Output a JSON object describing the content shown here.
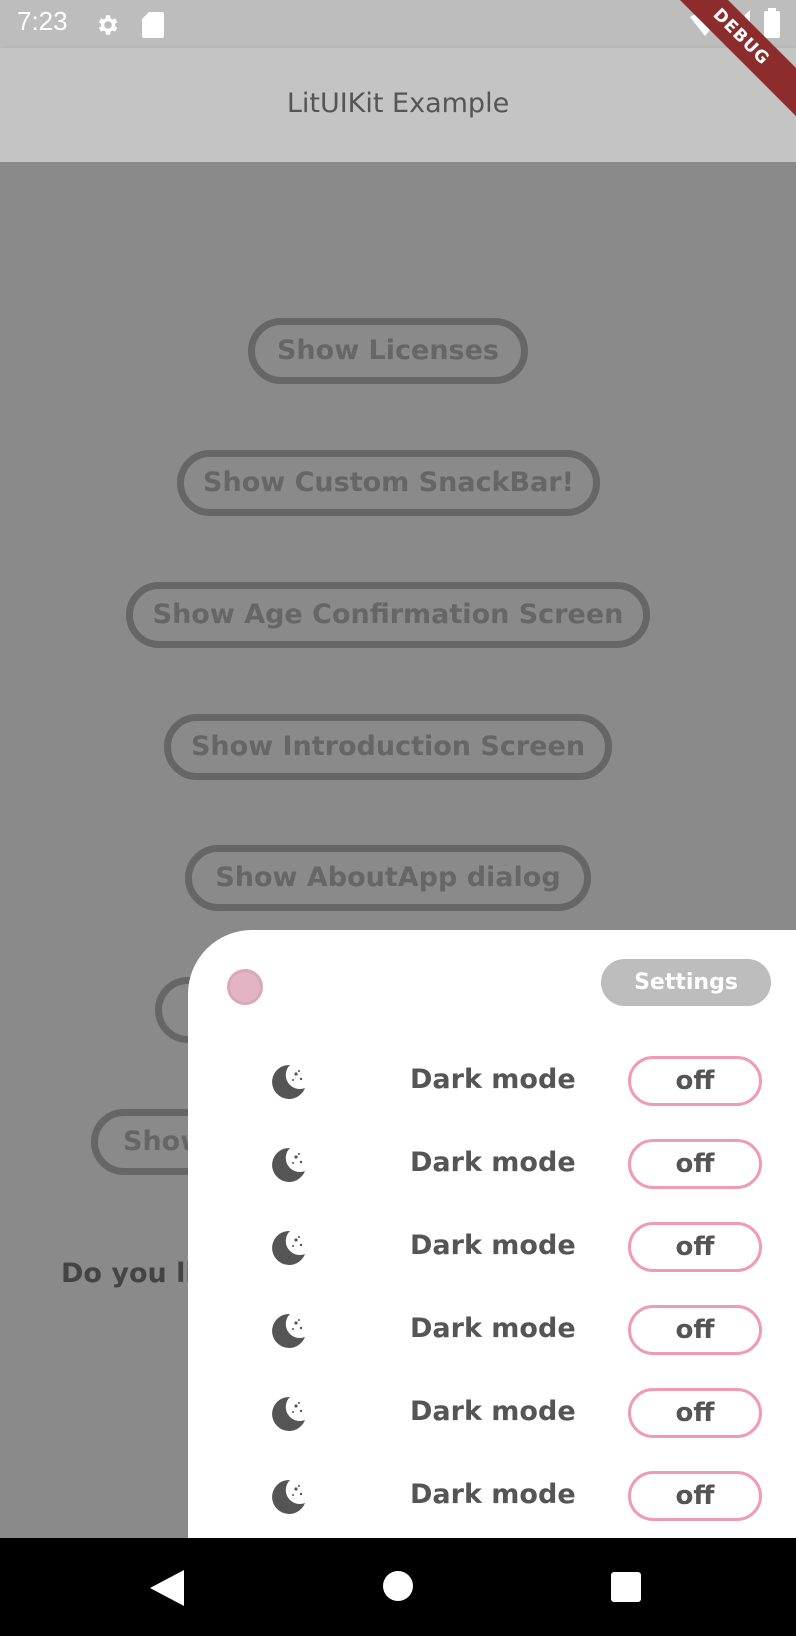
{
  "status_bar": {
    "time": "7:23",
    "icons": [
      "gear-icon",
      "sd-card-icon",
      "wifi-icon",
      "signal-icon",
      "battery-icon"
    ]
  },
  "debug_banner": "DEBUG",
  "app_bar": {
    "title": "LitUIKit Example"
  },
  "buttons": [
    {
      "label": "Show Licenses"
    },
    {
      "label": "Show Custom SnackBar!"
    },
    {
      "label": "Show Age Confirmation Screen"
    },
    {
      "label": "Show Introduction Screen"
    },
    {
      "label": "Show AboutApp dialog"
    },
    {
      "label": ""
    },
    {
      "label": "Show"
    }
  ],
  "question_text": "Do you li",
  "sheet": {
    "settings_label": "Settings",
    "rows": [
      {
        "label": "Dark mode",
        "toggle": "off",
        "icon": "moon-stars-icon"
      },
      {
        "label": "Dark mode",
        "toggle": "off",
        "icon": "moon-stars-icon"
      },
      {
        "label": "Dark mode",
        "toggle": "off",
        "icon": "moon-stars-icon"
      },
      {
        "label": "Dark mode",
        "toggle": "off",
        "icon": "moon-stars-icon"
      },
      {
        "label": "Dark mode",
        "toggle": "off",
        "icon": "moon-stars-icon"
      },
      {
        "label": "Dark mode",
        "toggle": "off",
        "icon": "moon-stars-icon"
      }
    ]
  },
  "nav_bar": {
    "icons": [
      "back-icon",
      "home-icon",
      "recents-icon"
    ]
  },
  "colors": {
    "accent": "#ee9bb3",
    "scrim": "#8a8a8a",
    "app_bar": "#c4c4c4",
    "debug": "#8c2c2c"
  }
}
